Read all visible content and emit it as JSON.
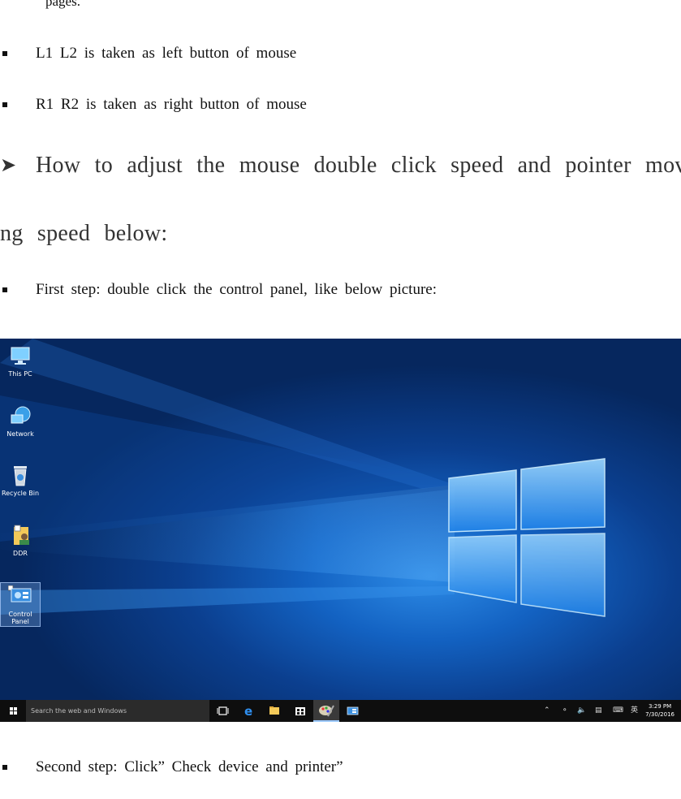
{
  "document": {
    "fragment": "pages.",
    "bullets_top": [
      "L1  L2  is  taken  as  left  button  of  mouse",
      "R1  R2  is  taken  as  right  button  of  mouse"
    ],
    "heading_line1": "How  to  adjust  the  mouse  double  click  speed  and  pointer  movi",
    "heading_line2": "ng  speed  below:",
    "step1": "First  step:  double  click  the  control  panel,  like  below  picture:",
    "step2": "Second  step:  Click”  Check  device  and  printer”"
  },
  "desktop": {
    "icons": [
      {
        "label": "This PC",
        "icon": "computer-icon"
      },
      {
        "label": "Network",
        "icon": "network-icon"
      },
      {
        "label": "Recycle Bin",
        "icon": "recycle-bin-icon"
      },
      {
        "label": "DDR",
        "icon": "user-folder-icon"
      },
      {
        "label": "Control\nPanel",
        "icon": "control-panel-icon"
      }
    ],
    "control_panel_label_1": "Control",
    "control_panel_label_2": "Panel",
    "taskbar": {
      "search_placeholder": "Search the web and Windows",
      "ime": "英",
      "time": "3:29 PM",
      "date": "7/30/2016"
    }
  }
}
